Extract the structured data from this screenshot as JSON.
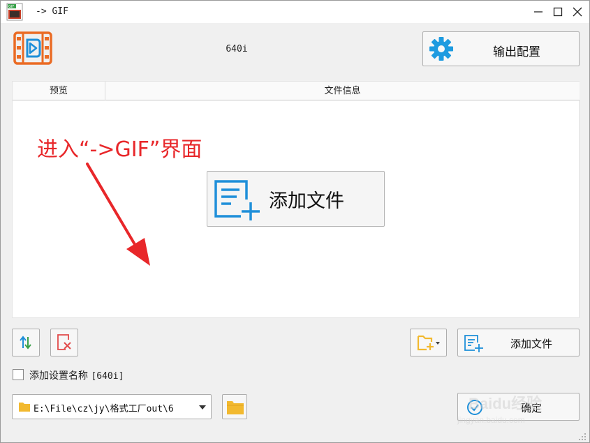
{
  "window": {
    "title": "-> GIF",
    "colors": {
      "accent_orange": "#ea6b24",
      "accent_blue": "#1e8fd9",
      "remove_red": "#e24b4b",
      "folder_yellow": "#f2b92f",
      "annotation_red": "#e8272a"
    }
  },
  "toolbar": {
    "preset_name": "640i",
    "output_config_label": "输出配置",
    "output_config_icon": "gear-icon"
  },
  "file_list": {
    "columns": [
      "预览",
      "文件信息"
    ],
    "rows": []
  },
  "annotation": {
    "text": "进入“->GIF”界面"
  },
  "center_add": {
    "label": "添加文件",
    "icon": "add-file-icon"
  },
  "bottom": {
    "add_file_label": "添加文件",
    "checkbox_label": "添加设置名称",
    "checkbox_value": "[640i]",
    "checkbox_checked": false,
    "output_path": "E:\\File\\cz\\jy\\格式工厂out\\6",
    "ok_label": "确定"
  },
  "watermark": {
    "brand": "Baidu经验",
    "url": "jingyan.baidu.com"
  }
}
